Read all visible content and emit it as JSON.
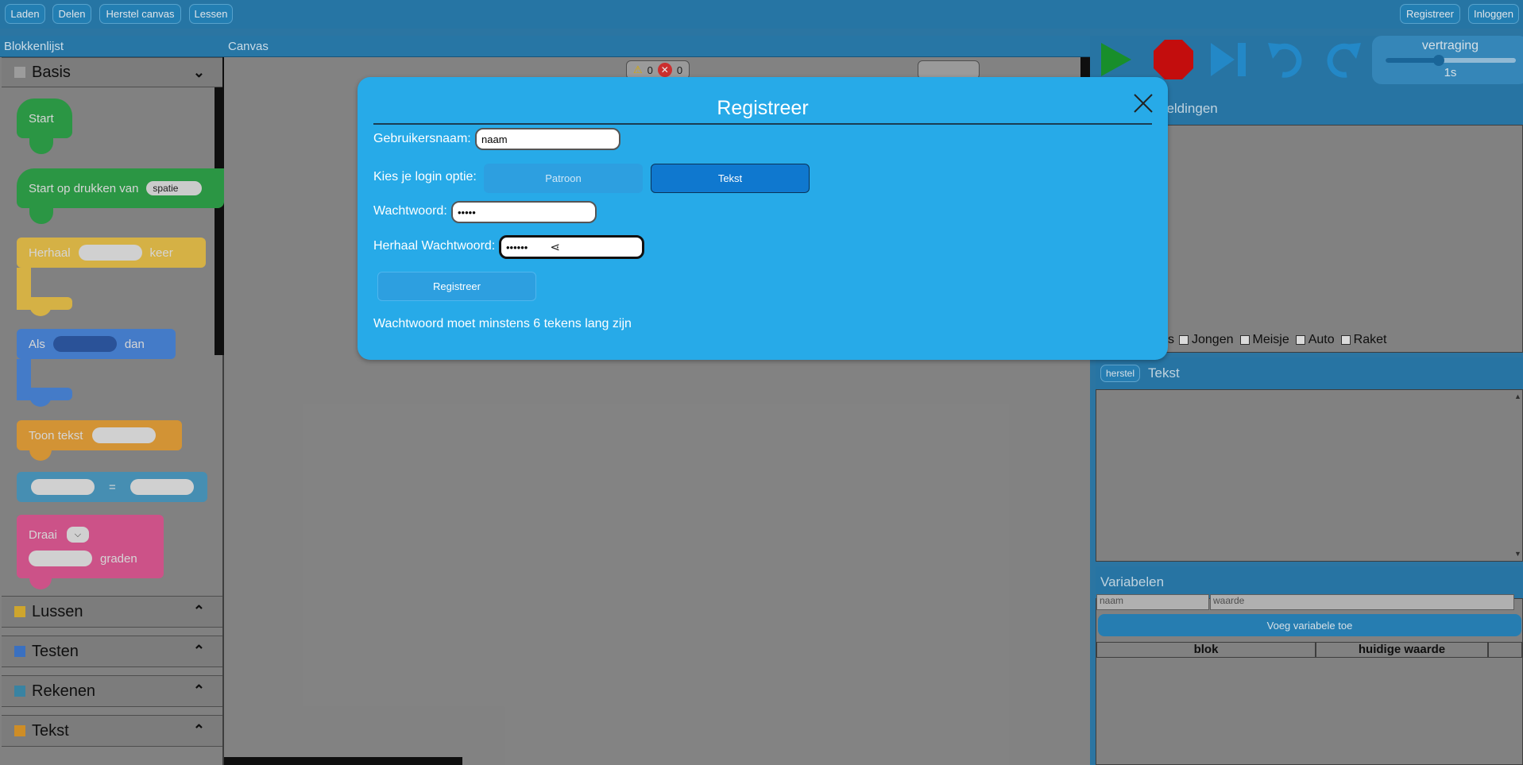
{
  "topbar": {
    "left_buttons": [
      "Laden",
      "Delen",
      "Herstel canvas",
      "Lessen"
    ],
    "right_buttons": [
      "Registreer",
      "Inloggen"
    ]
  },
  "panels": {
    "blocks_title": "Blokkenlijst",
    "canvas_title": "Canvas"
  },
  "sidebar": {
    "open_category": "Basis",
    "blocks": {
      "start": "Start",
      "start_key_prefix": "Start op drukken van",
      "start_key_value": "spatie",
      "repeat_prefix": "Herhaal",
      "repeat_suffix": "keer",
      "if_prefix": "Als",
      "if_suffix": "dan",
      "show_text": "Toon tekst",
      "equals": "=",
      "turn_prefix": "Draai",
      "turn_suffix": "graden"
    },
    "categories": [
      {
        "label": "Lussen",
        "color": "#e0b431"
      },
      {
        "label": "Testen",
        "color": "#3f7ad1"
      },
      {
        "label": "Rekenen",
        "color": "#3e8fb0"
      },
      {
        "label": "Tekst",
        "color": "#e0992a"
      }
    ]
  },
  "canvas": {
    "warning_count": "0",
    "error_count": "0"
  },
  "controls": {
    "delay_label": "vertraging",
    "delay_value": "1s"
  },
  "right": {
    "images_title": "eeldingen",
    "image_options_partial": "s",
    "image_options": [
      "Jongen",
      "Meisje",
      "Auto",
      "Raket"
    ],
    "reset_button": "herstel",
    "text_title": "Tekst",
    "variables_title": "Variabelen",
    "var_name_placeholder": "naam",
    "var_value_placeholder": "waarde",
    "add_variable_button": "Voeg variabele toe",
    "table_headers": [
      "blok",
      "huidige waarde",
      ""
    ]
  },
  "modal": {
    "title": "Registreer",
    "username_label": "Gebruikersnaam:",
    "username_value": "naam",
    "login_option_label": "Kies je login optie:",
    "option_pattern": "Patroon",
    "option_text": "Tekst",
    "password_label": "Wachtwoord:",
    "password_value": "•••••",
    "repeat_password_label": "Herhaal Wachtwoord:",
    "repeat_password_value": "••••••",
    "submit_button": "Registreer",
    "error_message": "Wachtwoord moet minstens 6 tekens lang zijn"
  }
}
